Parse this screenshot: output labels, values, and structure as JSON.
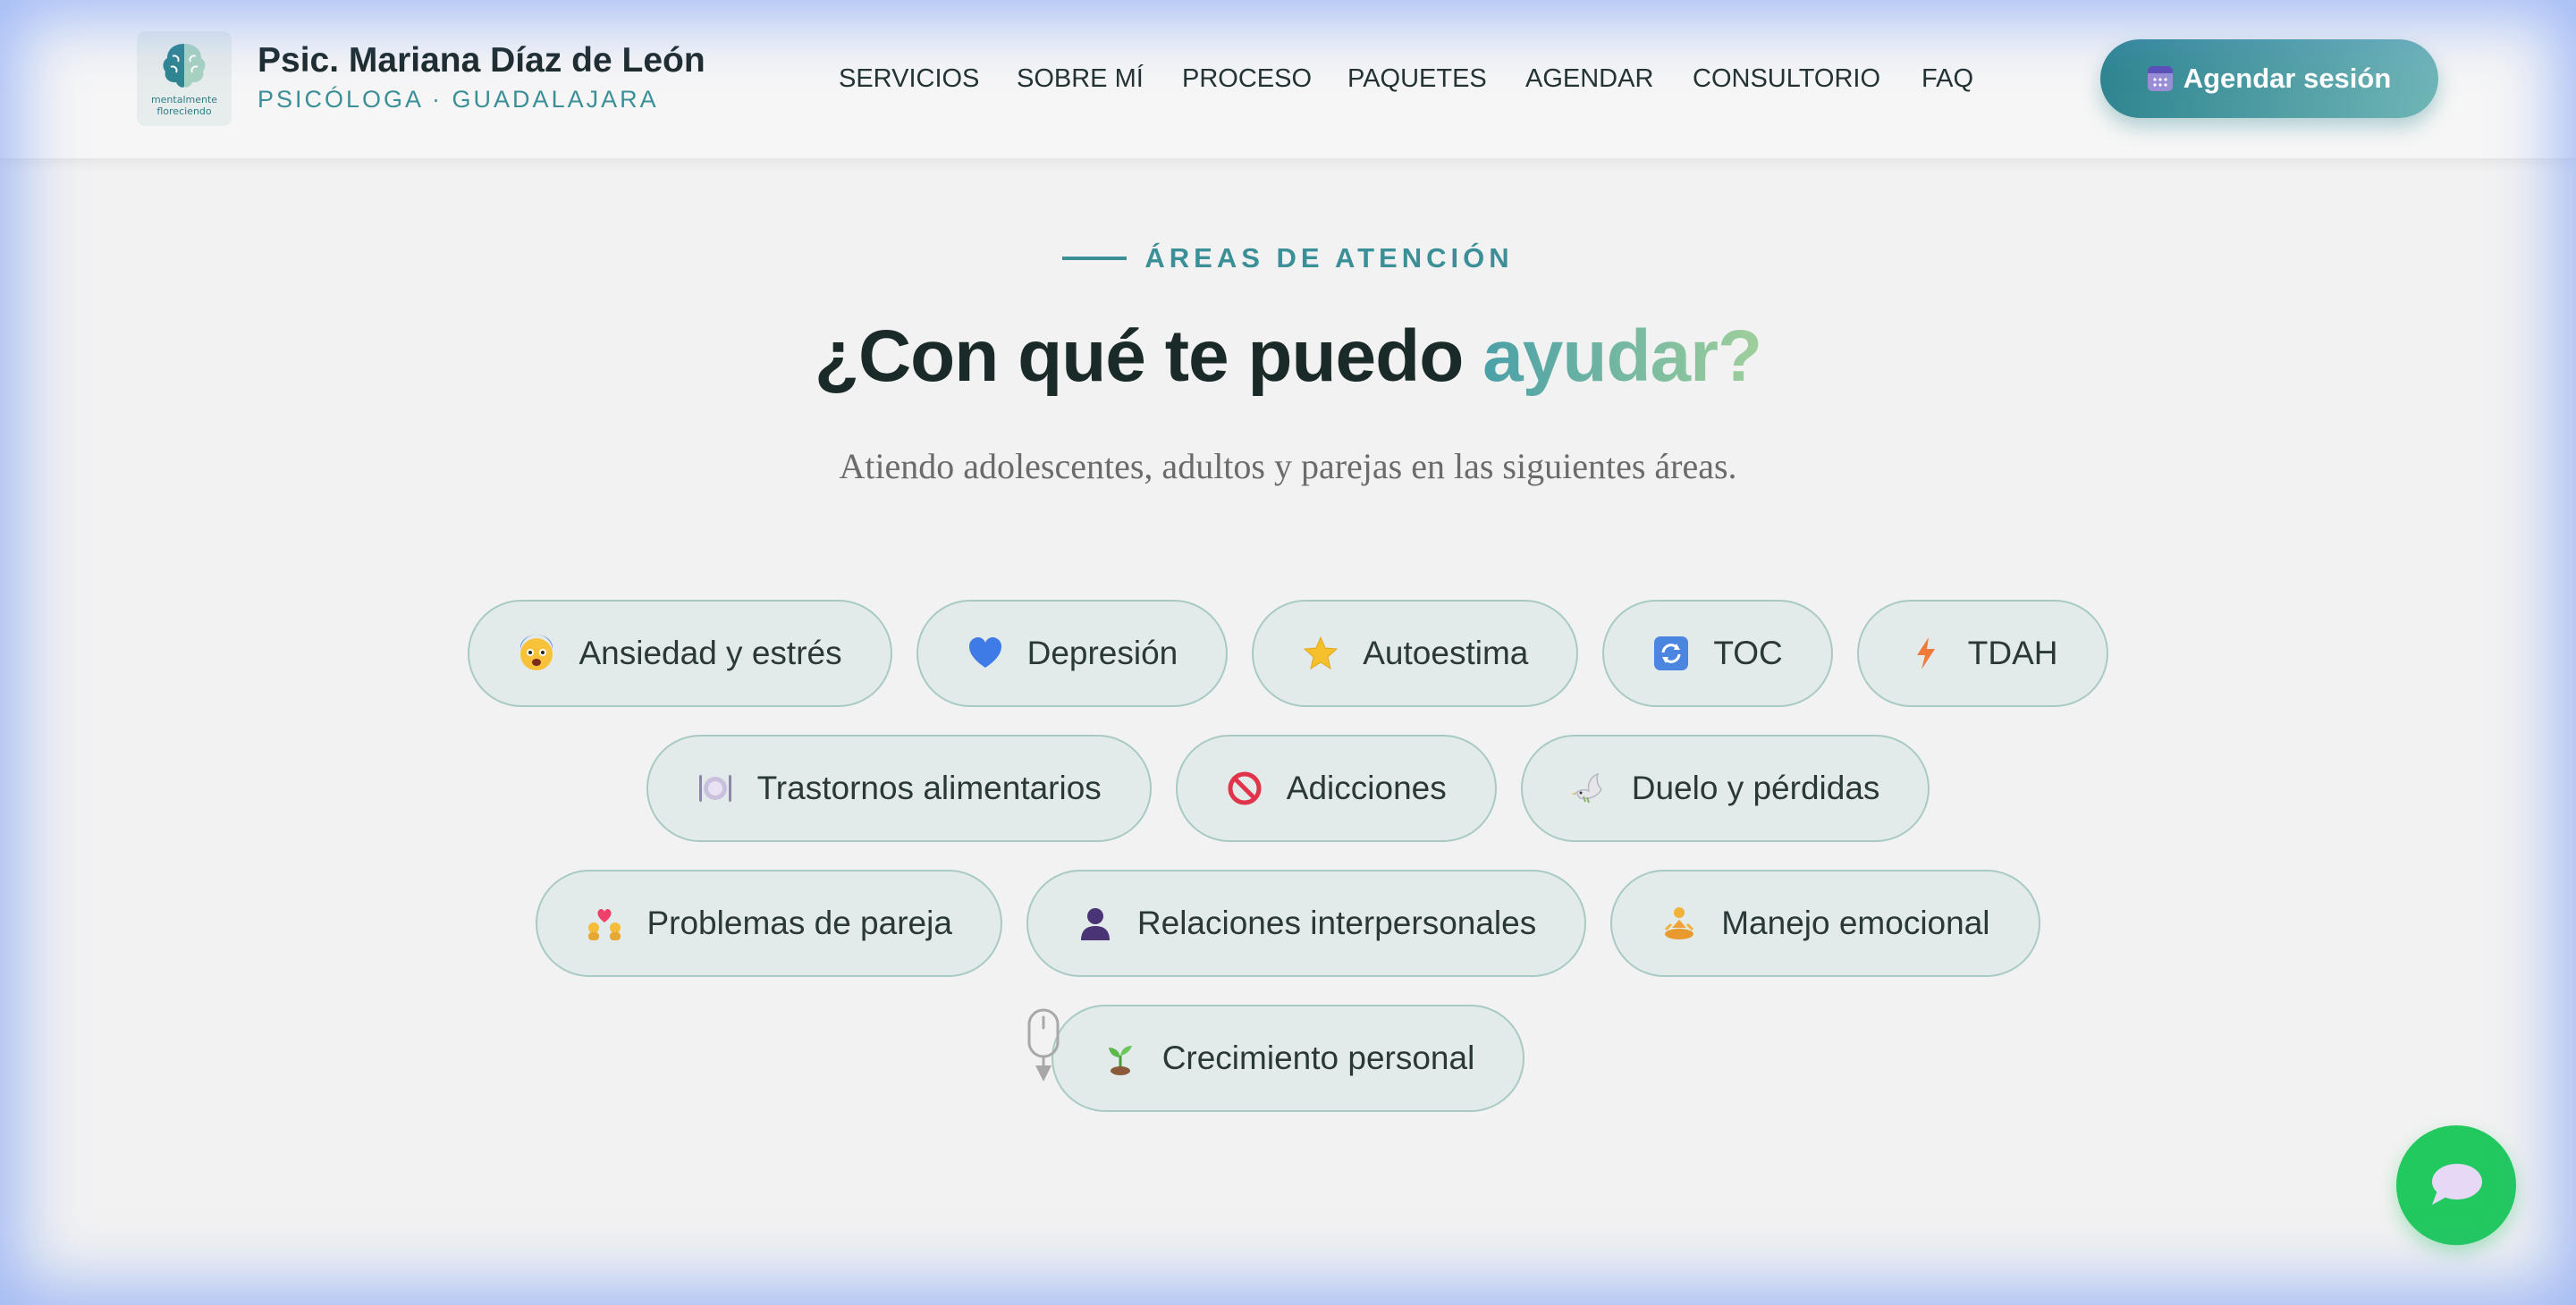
{
  "brand": {
    "logo_caption_line1": "mentalmente",
    "logo_caption_line2": "floreciendo",
    "name": "Psic. Mariana Díaz de León",
    "subtitle": "PSICÓLOGA · GUADALAJARA"
  },
  "nav": {
    "items": [
      {
        "label": "SERVICIOS"
      },
      {
        "label": "SOBRE MÍ"
      },
      {
        "label": "PROCESO"
      },
      {
        "label": "PAQUETES"
      },
      {
        "label": "AGENDAR"
      },
      {
        "label": "CONSULTORIO"
      },
      {
        "label": "FAQ"
      }
    ],
    "cta_label": "Agendar sesión",
    "cta_icon": "calendar-icon"
  },
  "section": {
    "eyebrow": "ÁREAS DE ATENCIÓN",
    "title_main": "¿Con qué te puedo ",
    "title_accent": "ayudar?",
    "subtitle": "Atiendo adolescentes, adultos y parejas en las siguientes áreas."
  },
  "areas": [
    {
      "label": "Ansiedad y estrés",
      "icon": "anxious-face-icon"
    },
    {
      "label": "Depresión",
      "icon": "blue-heart-icon"
    },
    {
      "label": "Autoestima",
      "icon": "star-icon"
    },
    {
      "label": "TOC",
      "icon": "repeat-arrows-icon"
    },
    {
      "label": "TDAH",
      "icon": "lightning-icon"
    },
    {
      "label": "Trastornos alimentarios",
      "icon": "plate-cutlery-icon"
    },
    {
      "label": "Adicciones",
      "icon": "prohibited-icon"
    },
    {
      "label": "Duelo y pérdidas",
      "icon": "dove-icon"
    },
    {
      "label": "Problemas de pareja",
      "icon": "couple-heart-icon"
    },
    {
      "label": "Relaciones interpersonales",
      "icon": "person-silhouette-icon"
    },
    {
      "label": "Manejo emocional",
      "icon": "meditation-icon"
    },
    {
      "label": "Crecimiento personal",
      "icon": "seedling-icon"
    }
  ],
  "chat": {
    "icon": "chat-bubble-icon"
  },
  "colors": {
    "accent": "#3b8f97",
    "cta_start": "#2f8590",
    "cta_end": "#6fb5b6",
    "chip_bg": "#e3ebea",
    "chip_border": "#a9cac4",
    "chat_fab": "#22c95f"
  }
}
